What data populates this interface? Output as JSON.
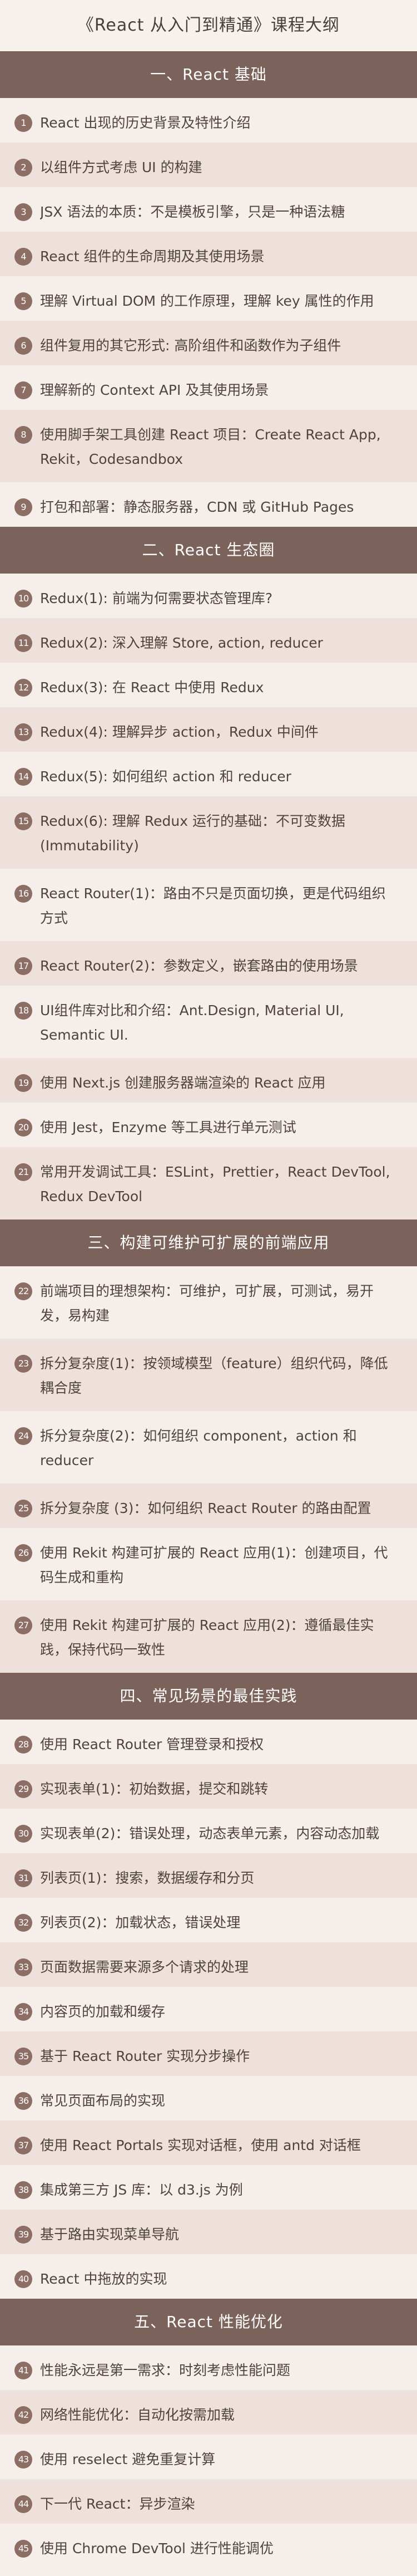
{
  "title": "《React 从入门到精通》课程大纲",
  "colors": {
    "section_background": "#7b625a",
    "row_light": "#f6eeea",
    "row_dark": "#eee1db",
    "number_badge": "#8c6e65"
  },
  "sections": [
    {
      "title": "一、React 基础",
      "items": [
        {
          "num": "1",
          "text": "React 出现的历史背景及特性介绍"
        },
        {
          "num": "2",
          "text": "以组件方式考虑 UI 的构建"
        },
        {
          "num": "3",
          "text": "JSX 语法的本质：不是模板引擎，只是一种语法糖"
        },
        {
          "num": "4",
          "text": "React 组件的生命周期及其使用场景"
        },
        {
          "num": "5",
          "text": "理解 Virtual DOM 的工作原理，理解 key 属性的作用"
        },
        {
          "num": "6",
          "text": "组件复用的其它形式: 高阶组件和函数作为子组件"
        },
        {
          "num": "7",
          "text": "理解新的 Context API 及其使用场景"
        },
        {
          "num": "8",
          "text": "使用脚手架工具创建 React 项目：Create React App, Rekit，Codesandbox"
        },
        {
          "num": "9",
          "text": "打包和部署：静态服务器，CDN 或 GitHub Pages"
        }
      ]
    },
    {
      "title": "二、React 生态圈",
      "items": [
        {
          "num": "10",
          "text": "Redux(1): 前端为何需要状态管理库?"
        },
        {
          "num": "11",
          "text": "Redux(2): 深入理解 Store, action, reducer"
        },
        {
          "num": "12",
          "text": "Redux(3): 在 React 中使用 Redux"
        },
        {
          "num": "13",
          "text": "Redux(4): 理解异步 action，Redux 中间件"
        },
        {
          "num": "14",
          "text": "Redux(5): 如何组织 action 和 reducer"
        },
        {
          "num": "15",
          "text": "Redux(6): 理解 Redux 运行的基础：不可变数据 (Immutability)"
        },
        {
          "num": "16",
          "text": "React Router(1)：路由不只是页面切换，更是代码组织方式"
        },
        {
          "num": "17",
          "text": "React Router(2)：参数定义，嵌套路由的使用场景"
        },
        {
          "num": "18",
          "text": "UI组件库对比和介绍：Ant.Design, Material UI, Semantic UI."
        },
        {
          "num": "19",
          "text": "使用 Next.js 创建服务器端渲染的 React 应用"
        },
        {
          "num": "20",
          "text": "使用 Jest，Enzyme 等工具进行单元测试"
        },
        {
          "num": "21",
          "text": "常用开发调试工具：ESLint，Prettier，React DevTool, Redux DevTool"
        }
      ]
    },
    {
      "title": "三、构建可维护可扩展的前端应用",
      "items": [
        {
          "num": "22",
          "text": "前端项目的理想架构：可维护，可扩展，可测试，易开发，易构建"
        },
        {
          "num": "23",
          "text": "拆分复杂度(1)：按领域模型（feature）组织代码，降低耦合度"
        },
        {
          "num": "24",
          "text": "拆分复杂度(2)：如何组织 component，action 和 reducer"
        },
        {
          "num": "25",
          "text": "拆分复杂度 (3)：如何组织 React Router 的路由配置"
        },
        {
          "num": "26",
          "text": "使用 Rekit 构建可扩展的 React 应用(1)：创建项目，代码生成和重构"
        },
        {
          "num": "27",
          "text": "使用 Rekit 构建可扩展的 React 应用(2)：遵循最佳实践，保持代码一致性"
        }
      ]
    },
    {
      "title": "四、常见场景的最佳实践",
      "items": [
        {
          "num": "28",
          "text": "使用 React Router 管理登录和授权"
        },
        {
          "num": "29",
          "text": "实现表单(1)：初始数据，提交和跳转"
        },
        {
          "num": "30",
          "text": "实现表单(2)：错误处理，动态表单元素，内容动态加载"
        },
        {
          "num": "31",
          "text": "列表页(1)：搜索，数据缓存和分页"
        },
        {
          "num": "32",
          "text": "列表页(2)：加载状态，错误处理"
        },
        {
          "num": "33",
          "text": "页面数据需要来源多个请求的处理"
        },
        {
          "num": "34",
          "text": "内容页的加载和缓存"
        },
        {
          "num": "35",
          "text": "基于 React Router 实现分步操作"
        },
        {
          "num": "36",
          "text": "常见页面布局的实现"
        },
        {
          "num": "37",
          "text": "使用 React Portals 实现对话框，使用 antd 对话框"
        },
        {
          "num": "38",
          "text": "集成第三方 JS 库：以 d3.js 为例"
        },
        {
          "num": "39",
          "text": "基于路由实现菜单导航"
        },
        {
          "num": "40",
          "text": "React 中拖放的实现"
        }
      ]
    },
    {
      "title": "五、React 性能优化",
      "items": [
        {
          "num": "41",
          "text": "性能永远是第一需求：时刻考虑性能问题"
        },
        {
          "num": "42",
          "text": "网络性能优化：自动化按需加载"
        },
        {
          "num": "43",
          "text": "使用 reselect 避免重复计算"
        },
        {
          "num": "44",
          "text": "下一代 React：异步渲染"
        },
        {
          "num": "45",
          "text": "使用 Chrome DevTool 进行性能调优"
        }
      ]
    }
  ]
}
